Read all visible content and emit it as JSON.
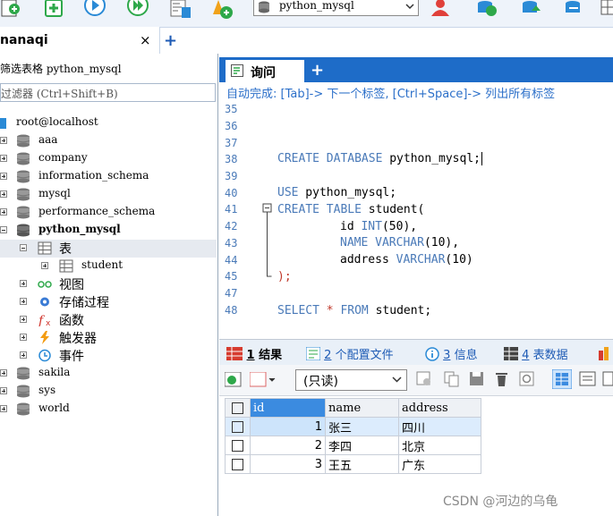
{
  "toolbar": {
    "database_selector": "python_mysql"
  },
  "connection_tab": {
    "label": "nanaqi",
    "close": "×",
    "add": "+"
  },
  "left": {
    "filter_label": "筛选表格 python_mysql",
    "filter_placeholder": "过滤器 (Ctrl+Shift+B)",
    "connection": "root@localhost",
    "databases": [
      "aaa",
      "company",
      "information_schema",
      "mysql",
      "performance_schema",
      "python_mysql",
      "sakila",
      "sys",
      "world"
    ],
    "tables_node": "表",
    "table": "student",
    "views": "视图",
    "procedures": "存储过程",
    "functions": "函数",
    "triggers": "触发器",
    "events": "事件"
  },
  "query_tab": {
    "label": "询问",
    "add": "+"
  },
  "autocomplete_hint": "自动完成: [Tab]-> 下一个标签, [Ctrl+Space]-> 列出所有标签",
  "editor": {
    "line_numbers": [
      "35",
      "36",
      "37",
      "38",
      "39",
      "40",
      "41",
      "42",
      "43",
      "44",
      "45",
      "47",
      "48"
    ],
    "l38_kw": "CREATE DATABASE",
    "l38_rest": " python_mysql;",
    "l40_kw": "USE",
    "l40_rest": " python_mysql;",
    "l41_kw": "CREATE TABLE",
    "l41_rest": " student(",
    "l42_a": "id ",
    "l42_kw": "INT",
    "l42_b": "(50),",
    "l43_kw1": "NAME",
    "l43_kw2": "VARCHAR",
    "l43_b": "(10),",
    "l44_a": "address ",
    "l44_kw": "VARCHAR",
    "l44_b": "(10)",
    "l45": ");",
    "l47_kw1": "SELECT",
    "l47_star": "*",
    "l47_kw2": "FROM",
    "l47_rest": " student;"
  },
  "result_tabs": {
    "t1_num": "1",
    "t1": "结果",
    "t2_num": "2",
    "t2": "个配置文件",
    "t3_num": "3",
    "t3": "信息",
    "t4_num": "4",
    "t4": "表数据"
  },
  "result_toolbar": {
    "mode": "(只读)"
  },
  "grid": {
    "columns": [
      "id",
      "name",
      "address"
    ],
    "rows": [
      {
        "id": "1",
        "name": "张三",
        "address": "四川"
      },
      {
        "id": "2",
        "name": "李四",
        "address": "北京"
      },
      {
        "id": "3",
        "name": "王五",
        "address": "广东"
      }
    ]
  },
  "watermark": "CSDN @河边的乌龟",
  "colors": {
    "accent": "#1e6cc8",
    "keyword": "#4a7ab8",
    "selected_row": "#dcecfd"
  }
}
